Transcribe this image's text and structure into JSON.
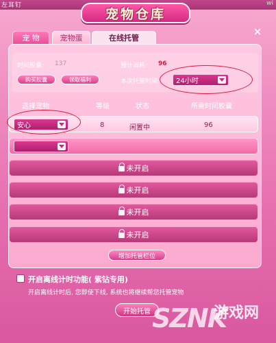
{
  "topbar": {
    "left_text": "左耳钉",
    "right_text": "wi"
  },
  "window": {
    "title": "宠物仓库",
    "close": "×"
  },
  "tabs": [
    {
      "label": "宠 物"
    },
    {
      "label": "宠物蛋"
    },
    {
      "label": "在线托管"
    }
  ],
  "info": {
    "capsule_label": "时间胶囊:",
    "capsule_value": "137",
    "consume_label": "预计消耗:",
    "consume_value": "96",
    "buy_button": "购买胶囊",
    "claim_button": "领取福利",
    "duration_label": "本次托管时间:",
    "duration_value": "24小时"
  },
  "table": {
    "headers": [
      "选择宠物",
      "等级",
      "状态",
      "所需时间胶囊"
    ],
    "rows": [
      {
        "pet": "安心",
        "level": "8",
        "status": "闲置中",
        "capsules": "96"
      }
    ],
    "locked_label": "未开启",
    "locked_slots": 4,
    "add_slot_button": "增加托管栏位"
  },
  "offline": {
    "title": "开启离线计时功能( 紫钻专用)",
    "desc": "开启离线计时后, 您即使下线, 系统也将继续帮您托管宠物",
    "start_button": "开始托管"
  },
  "watermark": {
    "logo": "SZNK",
    "cn": "游戏网",
    "url": ""
  },
  "colors": {
    "accent": "#e8509a",
    "highlight_oval": "#e0173a",
    "value_red": "#d71c3b"
  }
}
